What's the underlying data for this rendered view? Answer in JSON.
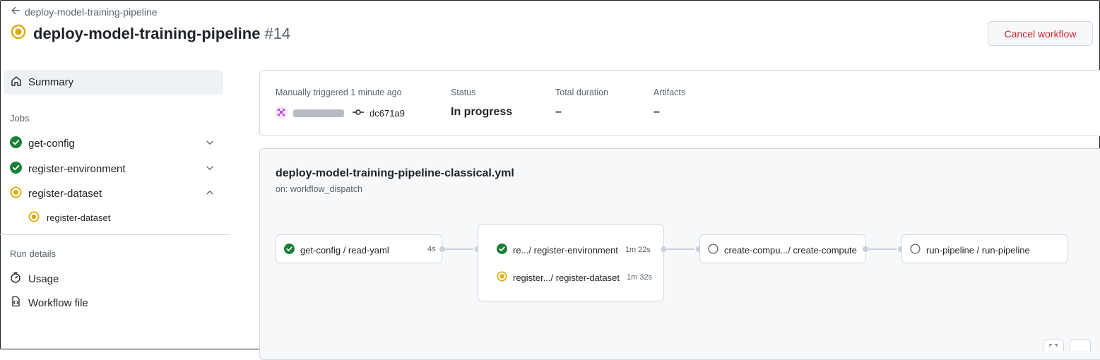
{
  "header": {
    "back_label": "deploy-model-training-pipeline",
    "title": "deploy-model-training-pipeline",
    "run_number": "#14",
    "cancel_label": "Cancel workflow"
  },
  "sidebar": {
    "summary_label": "Summary",
    "jobs_heading": "Jobs",
    "jobs": [
      {
        "label": "get-config",
        "status": "success"
      },
      {
        "label": "register-environment",
        "status": "success"
      },
      {
        "label": "register-dataset",
        "status": "in-progress"
      }
    ],
    "sub_job_label": "register-dataset",
    "run_details_heading": "Run details",
    "usage_label": "Usage",
    "workflow_file_label": "Workflow file"
  },
  "summary": {
    "trigger_label": "Manually triggered 1 minute ago",
    "commit": "dc671a9",
    "status_label": "Status",
    "status_value": "In progress",
    "duration_label": "Total duration",
    "duration_value": "–",
    "artifacts_label": "Artifacts",
    "artifacts_value": "–"
  },
  "graph": {
    "workflow_file": "deploy-model-training-pipeline-classical.yml",
    "trigger": "on: workflow_dispatch",
    "nodes": {
      "get_config": {
        "label": "get-config / read-yaml",
        "duration": "4s"
      },
      "register_env": {
        "label": "re.../ register-environment",
        "duration": "1m 22s"
      },
      "register_dataset": {
        "label": "register.../ register-dataset",
        "duration": "1m 32s"
      },
      "create_compute": {
        "label": "create-compu.../ create-compute"
      },
      "run_pipeline": {
        "label": "run-pipeline / run-pipeline"
      }
    }
  },
  "colors": {
    "success": "#1a7f37",
    "in_progress": "#dbab0a",
    "danger": "#d1242f",
    "muted": "#59636e",
    "border": "#d1d9e0"
  }
}
